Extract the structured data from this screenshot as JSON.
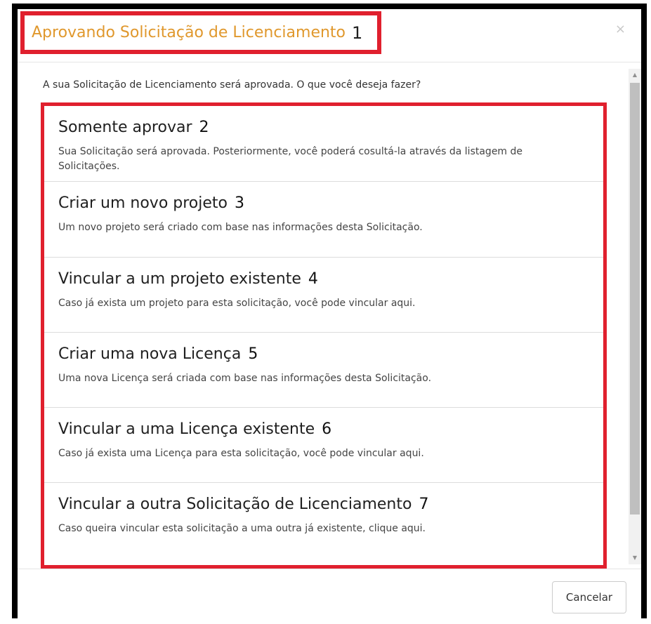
{
  "header": {
    "title": "Aprovando Solicitação de Licenciamento",
    "title_number": "1",
    "close_symbol": "×"
  },
  "body": {
    "intro": "A sua Solicitação de Licenciamento será aprovada. O que você deseja fazer?",
    "options": [
      {
        "title": "Somente aprovar",
        "number": "2",
        "description": "Sua Solicitação será aprovada. Posteriormente, você poderá cosultá-la através da listagem de Solicitações."
      },
      {
        "title": "Criar um novo projeto",
        "number": "3",
        "description": "Um novo projeto será criado com base nas informações desta Solicitação."
      },
      {
        "title": "Vincular a um projeto existente",
        "number": "4",
        "description": "Caso já exista um projeto para esta solicitação, você pode vincular aqui."
      },
      {
        "title": "Criar uma nova Licença",
        "number": "5",
        "description": "Uma nova Licença será criada com base nas informações desta Solicitação."
      },
      {
        "title": "Vincular a uma Licença existente",
        "number": "6",
        "description": "Caso já exista uma Licença para esta solicitação, você pode vincular aqui."
      },
      {
        "title": "Vincular a outra Solicitação de Licenciamento",
        "number": "7",
        "description": "Caso queira vincular esta solicitação a uma outra já existente, clique aqui."
      }
    ]
  },
  "footer": {
    "cancel_label": "Cancelar"
  },
  "colors": {
    "title": "#e0982d",
    "highlight_border": "#e0202e",
    "frame": "#000000"
  },
  "icons": {
    "close": "close-icon",
    "scroll_up": "scroll-up-arrow-icon",
    "scroll_down": "scroll-down-arrow-icon"
  }
}
